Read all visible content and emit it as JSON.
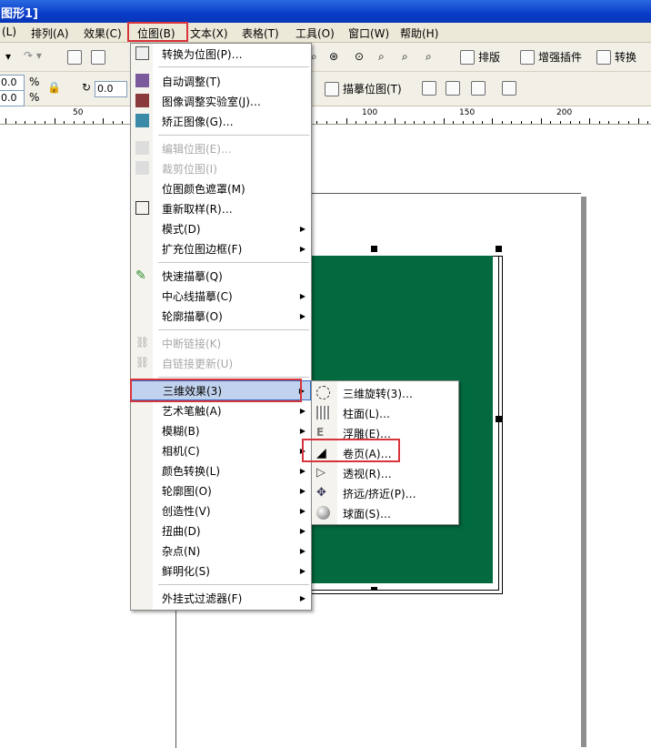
{
  "window": {
    "title": "图形1]"
  },
  "menubar": {
    "items": [
      {
        "label": "(L)"
      },
      {
        "label": "排列(A)"
      },
      {
        "label": "效果(C)"
      },
      {
        "label": "位图(B)"
      },
      {
        "label": "文本(X)"
      },
      {
        "label": "表格(T)"
      },
      {
        "label": "工具(O)"
      },
      {
        "label": "窗口(W)"
      },
      {
        "label": "帮助(H)"
      }
    ]
  },
  "toolbar": {
    "paiban": "排版",
    "plugin": "增强插件",
    "convert": "转换",
    "trace_bitmap": "描摹位图(T)",
    "field_x": "0.0",
    "field_y": "0.0",
    "unit1": "%",
    "unit2": "%",
    "rotate": "0.0"
  },
  "ruler": {
    "labels": [
      "50",
      "100",
      "150",
      "200"
    ]
  },
  "bitmap_menu": {
    "items": [
      {
        "label": "转换为位图(P)…"
      },
      {
        "label": "自动调整(T)"
      },
      {
        "label": "图像调整实验室(J)…"
      },
      {
        "label": "矫正图像(G)…"
      },
      {
        "label": "编辑位图(E)…"
      },
      {
        "label": "裁剪位图(I)"
      },
      {
        "label": "位图颜色遮罩(M)"
      },
      {
        "label": "重新取样(R)…"
      },
      {
        "label": "模式(D)"
      },
      {
        "label": "扩充位图边框(F)"
      },
      {
        "label": "快速描摹(Q)"
      },
      {
        "label": "中心线描摹(C)"
      },
      {
        "label": "轮廓描摹(O)"
      },
      {
        "label": "中断链接(K)"
      },
      {
        "label": "自链接更新(U)"
      },
      {
        "label": "三维效果(3)"
      },
      {
        "label": "艺术笔触(A)"
      },
      {
        "label": "模糊(B)"
      },
      {
        "label": "相机(C)"
      },
      {
        "label": "颜色转换(L)"
      },
      {
        "label": "轮廓图(O)"
      },
      {
        "label": "创造性(V)"
      },
      {
        "label": "扭曲(D)"
      },
      {
        "label": "杂点(N)"
      },
      {
        "label": "鲜明化(S)"
      },
      {
        "label": "外挂式过滤器(F)"
      }
    ]
  },
  "submenu_3d": {
    "items": [
      {
        "label": "三维旋转(3)…"
      },
      {
        "label": "柱面(L)…"
      },
      {
        "label": "浮雕(E)…"
      },
      {
        "label": "卷页(A)…"
      },
      {
        "label": "透视(R)…"
      },
      {
        "label": "挤远/挤近(P)…"
      },
      {
        "label": "球面(S)…"
      }
    ]
  },
  "colors": {
    "bitmap": "#036a40",
    "highlight_box": "#d8343b"
  }
}
